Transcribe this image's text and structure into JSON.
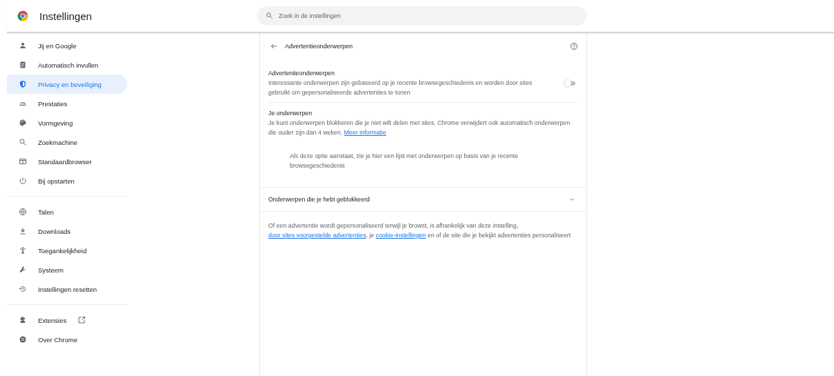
{
  "header": {
    "title": "Instellingen",
    "search": {
      "placeholder": "Zoek in de instellingen"
    }
  },
  "sidebar": {
    "groups": [
      {
        "items": [
          {
            "label": "Jij en Google",
            "selected": false
          },
          {
            "label": "Automatisch invullen",
            "selected": false
          },
          {
            "label": "Privacy en beveiliging",
            "selected": true
          },
          {
            "label": "Prestaties",
            "selected": false
          },
          {
            "label": "Vormgeving",
            "selected": false
          },
          {
            "label": "Zoekmachine",
            "selected": false
          },
          {
            "label": "Standaardbrowser",
            "selected": false
          },
          {
            "label": "Bij opstarten",
            "selected": false
          }
        ]
      },
      {
        "items": [
          {
            "label": "Talen",
            "selected": false
          },
          {
            "label": "Downloads",
            "selected": false
          },
          {
            "label": "Toegankelijkheid",
            "selected": false
          },
          {
            "label": "Systeem",
            "selected": false
          },
          {
            "label": "Instellingen resetten",
            "selected": false
          }
        ]
      },
      {
        "items": [
          {
            "label": "Extensies",
            "selected": false
          },
          {
            "label": "Over Chrome",
            "selected": false
          }
        ]
      }
    ]
  },
  "page": {
    "title": "Advertentieonderwerpen",
    "toggle_setting": {
      "title": "Advertentieonderwerpen",
      "description": "Interessante onderwerpen zijn gebaseerd op je recente browsegeschiedenis en worden door sites gebruikt om gepersonaliseerde advertenties te tonen",
      "on": false
    },
    "topics": {
      "title": "Je onderwerpen",
      "description": "Je kunt onderwerpen blokkeren die je niet wilt delen met sites. Chrome verwijdert ook automatisch onderwerpen die ouder zijn dan 4 weken.",
      "link": "Meer informatie",
      "empty_text": "Als deze optie aanstaat, zie je hier een lijst met onderwerpen op basis van je recente browsegeschiedenis"
    },
    "blocked": {
      "label": "Onderwerpen die je hebt geblokkeerd",
      "expanded": false
    },
    "footer": [
      {
        "kind": "text",
        "text": "Of een advertentie wordt gepersonaliseerd terwijl je browst, is afhankelijk van deze instelling,"
      },
      {
        "kind": "link",
        "text": "door sites voorgestelde advertenties"
      },
      {
        "kind": "text",
        "text": ", je"
      },
      {
        "kind": "link",
        "text": "cookie-instellingen"
      },
      {
        "kind": "text",
        "text": "en of de site die je bekijkt advertenties personaliseert"
      }
    ]
  }
}
